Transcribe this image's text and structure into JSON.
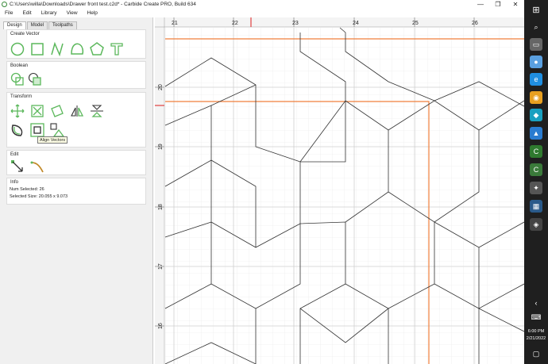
{
  "window": {
    "title": "C:\\Users\\willa\\Downloads\\Drawer front test.c2d* - Carbide Create PRO, Build 634",
    "minimize": "—",
    "maximize": "❐",
    "close": "✕"
  },
  "menu": [
    "File",
    "Edit",
    "Library",
    "View",
    "Help"
  ],
  "tabs": [
    "Design",
    "Model",
    "Toolpaths"
  ],
  "sections": {
    "create_vector": "Create Vector",
    "boolean": "Boolean",
    "transform": "Transform",
    "edit": "Edit",
    "info": "Info"
  },
  "tooltip": "Align Vectors",
  "info": {
    "num_selected_label": "Num Selected:",
    "num_selected_value": "26",
    "selected_size_label": "Selected Size:",
    "selected_size_value": "20.055 x 9.073"
  },
  "ruler": {
    "x_labels": [
      "21",
      "22",
      "23",
      "24",
      "25",
      "26"
    ],
    "y_labels": [
      "20",
      "19",
      "18",
      "17",
      "16"
    ]
  },
  "clock": {
    "time": "6:00 PM",
    "date": "2/21/2022"
  },
  "colors": {
    "accent": "#5cb85c",
    "guide": "#f07f3c",
    "taskbar": "#1f1f1f"
  }
}
